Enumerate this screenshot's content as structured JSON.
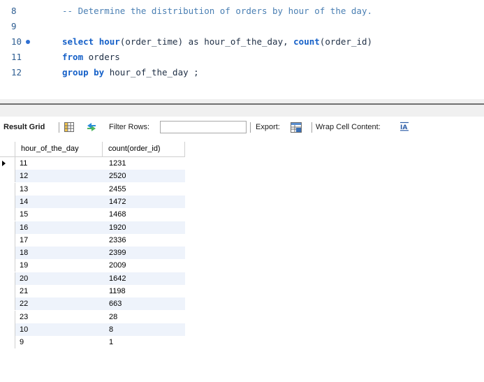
{
  "editor": {
    "lines": [
      {
        "number": "8",
        "executable": false,
        "tokens": [
          {
            "t": "-- Determine the distribution of orders by hour of the day.",
            "k": "comment"
          }
        ]
      },
      {
        "number": "9",
        "executable": false,
        "tokens": []
      },
      {
        "number": "10",
        "executable": true,
        "tokens": [
          {
            "t": "select",
            "k": "kw"
          },
          {
            "t": " ",
            "k": "pu"
          },
          {
            "t": "hour",
            "k": "fn"
          },
          {
            "t": "(order_time) as hour_of_the_day, ",
            "k": "id"
          },
          {
            "t": "count",
            "k": "fn"
          },
          {
            "t": "(order_id)",
            "k": "id"
          }
        ]
      },
      {
        "number": "11",
        "executable": false,
        "tokens": [
          {
            "t": "from",
            "k": "kw"
          },
          {
            "t": " orders",
            "k": "id"
          }
        ]
      },
      {
        "number": "12",
        "executable": false,
        "tokens": [
          {
            "t": "group by",
            "k": "kw"
          },
          {
            "t": " hour_of_the_day ;",
            "k": "id"
          }
        ]
      }
    ]
  },
  "toolbar": {
    "result_grid_label": "Result Grid",
    "filter_rows_label": "Filter Rows:",
    "filter_value": "",
    "export_label": "Export:",
    "wrap_label": "Wrap Cell Content:",
    "wrap_icon_text": "IA"
  },
  "grid": {
    "columns": [
      "hour_of_the_day",
      "count(order_id)"
    ],
    "rows": [
      [
        "11",
        "1231"
      ],
      [
        "12",
        "2520"
      ],
      [
        "13",
        "2455"
      ],
      [
        "14",
        "1472"
      ],
      [
        "15",
        "1468"
      ],
      [
        "16",
        "1920"
      ],
      [
        "17",
        "2336"
      ],
      [
        "18",
        "2399"
      ],
      [
        "19",
        "2009"
      ],
      [
        "20",
        "1642"
      ],
      [
        "21",
        "1198"
      ],
      [
        "22",
        "663"
      ],
      [
        "23",
        "28"
      ],
      [
        "10",
        "8"
      ],
      [
        "9",
        "1"
      ]
    ],
    "selected_row": 0
  },
  "colors": {
    "keyword": "#1560c8",
    "comment": "#4a7fb3",
    "exec_dot": "#2e6fd2",
    "alt_row": "#eef3fb"
  },
  "icons": {
    "grid": "result-grid-icon",
    "filter": "filter-arrows-icon",
    "export": "export-icon",
    "wrap": "wrap-cell-icon",
    "executable": "execution-dot-icon",
    "row_pointer": "row-pointer-icon"
  }
}
